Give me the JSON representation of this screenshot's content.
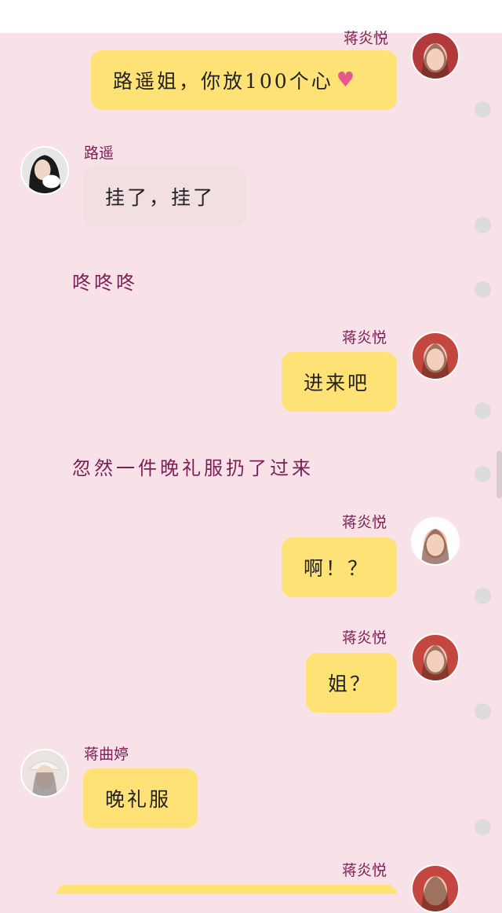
{
  "header": {
    "partial_name": "蒋炎悦"
  },
  "messages": [
    {
      "sender": "蒋炎悦",
      "side": "right",
      "text": "路遥姐，你放100个心",
      "icon": "heart-icon",
      "heart_glyph": "♥"
    },
    {
      "sender": "路遥",
      "side": "left",
      "text": "挂了，挂了"
    },
    {
      "type": "narration",
      "text": "咚咚咚"
    },
    {
      "sender": "蒋炎悦",
      "side": "right",
      "text": "进来吧"
    },
    {
      "type": "narration",
      "text": "忽然一件晚礼服扔了过来"
    },
    {
      "sender": "蒋炎悦",
      "side": "right",
      "text": "啊！？"
    },
    {
      "sender": "蒋炎悦",
      "side": "right",
      "text": "姐？"
    },
    {
      "sender": "蒋曲婷",
      "side": "left",
      "text": "晚礼服"
    },
    {
      "sender": "蒋炎悦",
      "side": "right",
      "text": ""
    }
  ],
  "colors": {
    "background": "#f9e1e8",
    "bubble_yellow": "#ffe276",
    "bubble_grey": "#f1dfe1",
    "name_text": "#7b1e55",
    "heart": "#e6588a"
  }
}
